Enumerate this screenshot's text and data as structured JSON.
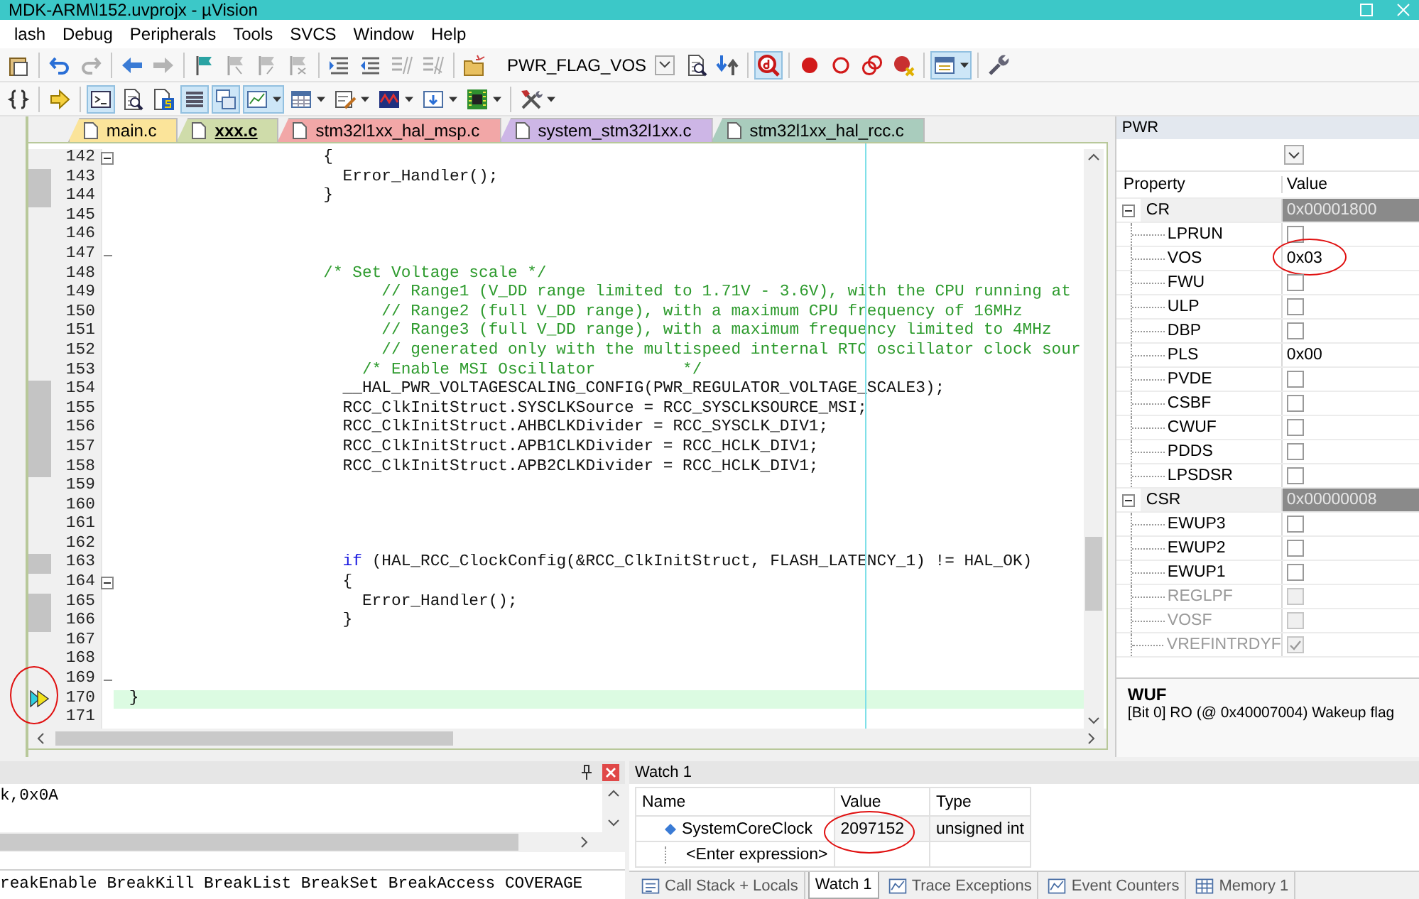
{
  "window": {
    "title": "MDK-ARM\\l152.uvprojx - µVision"
  },
  "menu": [
    "lash",
    "Debug",
    "Peripherals",
    "Tools",
    "SVCS",
    "Window",
    "Help"
  ],
  "toolbar_1": [
    {
      "kind": "button",
      "selected": false,
      "disabled": false,
      "dropdown": false
    },
    {
      "kind": "separator"
    },
    {
      "kind": "button",
      "selected": false,
      "disabled": false,
      "dropdown": false
    },
    {
      "kind": "button",
      "selected": false,
      "disabled": true,
      "dropdown": false
    },
    {
      "kind": "separator"
    },
    {
      "kind": "button",
      "selected": false,
      "disabled": false,
      "dropdown": false
    },
    {
      "kind": "button",
      "selected": false,
      "disabled": true,
      "dropdown": false
    },
    {
      "kind": "separator"
    },
    {
      "kind": "button",
      "selected": false,
      "disabled": false,
      "dropdown": false
    },
    {
      "kind": "button",
      "selected": false,
      "disabled": true,
      "dropdown": false
    },
    {
      "kind": "button",
      "selected": false,
      "disabled": true,
      "dropdown": false
    },
    {
      "kind": "button",
      "selected": false,
      "disabled": true,
      "dropdown": false
    },
    {
      "kind": "separator"
    },
    {
      "kind": "button",
      "selected": false,
      "disabled": false,
      "dropdown": false
    },
    {
      "kind": "button",
      "selected": false,
      "disabled": false,
      "dropdown": false
    },
    {
      "kind": "button",
      "selected": false,
      "disabled": true,
      "dropdown": false
    },
    {
      "kind": "button",
      "selected": false,
      "disabled": true,
      "dropdown": false
    },
    {
      "kind": "separator"
    },
    {
      "kind": "button",
      "selected": false,
      "disabled": false,
      "dropdown": false
    },
    {
      "kind": "combo",
      "value": "PWR_FLAG_VOS"
    },
    {
      "kind": "button",
      "selected": false,
      "disabled": false,
      "dropdown": false
    },
    {
      "kind": "button",
      "selected": false,
      "disabled": false,
      "dropdown": false
    },
    {
      "kind": "separator"
    },
    {
      "kind": "button",
      "selected": true,
      "disabled": false,
      "dropdown": false
    },
    {
      "kind": "separator"
    },
    {
      "kind": "button",
      "selected": false,
      "disabled": false,
      "dropdown": false
    },
    {
      "kind": "button",
      "selected": false,
      "disabled": false,
      "dropdown": false
    },
    {
      "kind": "button",
      "selected": false,
      "disabled": false,
      "dropdown": false
    },
    {
      "kind": "button",
      "selected": false,
      "disabled": false,
      "dropdown": false
    },
    {
      "kind": "separator"
    },
    {
      "kind": "button",
      "selected": true,
      "disabled": false,
      "dropdown": true
    },
    {
      "kind": "separator"
    },
    {
      "kind": "button",
      "selected": false,
      "disabled": false,
      "dropdown": false
    }
  ],
  "toolbar_2": [
    {
      "kind": "button",
      "selected": false,
      "disabled": false,
      "dropdown": false
    },
    {
      "kind": "separator"
    },
    {
      "kind": "button",
      "selected": false,
      "disabled": false,
      "dropdown": false
    },
    {
      "kind": "separator"
    },
    {
      "kind": "button",
      "selected": true,
      "disabled": false,
      "dropdown": false
    },
    {
      "kind": "button",
      "selected": false,
      "disabled": false,
      "dropdown": false
    },
    {
      "kind": "button",
      "selected": false,
      "disabled": false,
      "dropdown": false
    },
    {
      "kind": "button",
      "selected": true,
      "disabled": false,
      "dropdown": false
    },
    {
      "kind": "button",
      "selected": true,
      "disabled": false,
      "dropdown": false
    },
    {
      "kind": "button",
      "selected": true,
      "disabled": false,
      "dropdown": true
    },
    {
      "kind": "button",
      "selected": false,
      "disabled": false,
      "dropdown": true
    },
    {
      "kind": "button",
      "selected": false,
      "disabled": false,
      "dropdown": true
    },
    {
      "kind": "button",
      "selected": false,
      "disabled": false,
      "dropdown": true
    },
    {
      "kind": "button",
      "selected": false,
      "disabled": false,
      "dropdown": true
    },
    {
      "kind": "button",
      "selected": false,
      "disabled": false,
      "dropdown": true
    },
    {
      "kind": "separator"
    },
    {
      "kind": "button",
      "selected": false,
      "disabled": false,
      "dropdown": true
    }
  ],
  "editor_tabs": [
    {
      "label": "main.c",
      "selected": false,
      "color": "#fbe49a"
    },
    {
      "label": "xxx.c",
      "selected": true,
      "color": "#cfdcaa"
    },
    {
      "label": "stm32l1xx_hal_msp.c",
      "selected": false,
      "color": "#f2a7a7"
    },
    {
      "label": "system_stm32l1xx.c",
      "selected": false,
      "color": "#cdb6e6"
    },
    {
      "label": "stm32l1xx_hal_rcc.c",
      "selected": false,
      "color": "#a9ccbd"
    }
  ],
  "editor_lines": [
    {
      "number": "142",
      "covered": false,
      "current": false,
      "fold_start": true,
      "code": [
        {
          "kind": "plain",
          "text": "                    {"
        }
      ]
    },
    {
      "number": "143",
      "covered": true,
      "current": false,
      "code": [
        {
          "kind": "plain",
          "text": "                      Error_Handler();"
        }
      ]
    },
    {
      "number": "144",
      "covered": true,
      "current": false,
      "code": [
        {
          "kind": "plain",
          "text": "                    }"
        }
      ]
    },
    {
      "number": "145",
      "covered": false,
      "current": false
    },
    {
      "number": "146",
      "covered": false,
      "current": false
    },
    {
      "number": "147",
      "covered": false,
      "current": false,
      "fold_end": true
    },
    {
      "number": "148",
      "covered": false,
      "current": false,
      "code": [
        {
          "kind": "comment",
          "text": "                    /* Set Voltage scale */"
        }
      ]
    },
    {
      "number": "149",
      "covered": false,
      "current": false,
      "code": [
        {
          "kind": "comment",
          "text": "                          // Range1 (V_DD range limited to 1.71V - 3.6V), with the CPU running at"
        }
      ]
    },
    {
      "number": "150",
      "covered": false,
      "current": false,
      "code": [
        {
          "kind": "comment",
          "text": "                          // Range2 (full V_DD range), with a maximum CPU frequency of 16MHz"
        }
      ]
    },
    {
      "number": "151",
      "covered": false,
      "current": false,
      "code": [
        {
          "kind": "comment",
          "text": "                          // Range3 (full V_DD range), with a maximum frequency limited to 4MHz"
        }
      ]
    },
    {
      "number": "152",
      "covered": false,
      "current": false,
      "code": [
        {
          "kind": "comment",
          "text": "                          // generated only with the multispeed internal RTC oscillator clock sour"
        }
      ]
    },
    {
      "number": "153",
      "covered": false,
      "current": false,
      "code": [
        {
          "kind": "comment",
          "text": "                        /* Enable MSI Oscillator         */"
        }
      ]
    },
    {
      "number": "154",
      "covered": true,
      "current": false,
      "code": [
        {
          "kind": "plain",
          "text": "                      __HAL_PWR_VOLTAGESCALING_CONFIG(PWR_REGULATOR_VOLTAGE_SCALE3);"
        }
      ]
    },
    {
      "number": "155",
      "covered": true,
      "current": false,
      "code": [
        {
          "kind": "plain",
          "text": "                      RCC_ClkInitStruct.SYSCLKSource = RCC_SYSCLKSOURCE_MSI;"
        }
      ]
    },
    {
      "number": "156",
      "covered": true,
      "current": false,
      "code": [
        {
          "kind": "plain",
          "text": "                      RCC_ClkInitStruct.AHBCLKDivider = RCC_SYSCLK_DIV1;"
        }
      ]
    },
    {
      "number": "157",
      "covered": true,
      "current": false,
      "code": [
        {
          "kind": "plain",
          "text": "                      RCC_ClkInitStruct.APB1CLKDivider = RCC_HCLK_DIV1;"
        }
      ]
    },
    {
      "number": "158",
      "covered": true,
      "current": false,
      "code": [
        {
          "kind": "plain",
          "text": "                      RCC_ClkInitStruct.APB2CLKDivider = RCC_HCLK_DIV1;"
        }
      ]
    },
    {
      "number": "159",
      "covered": false,
      "current": false
    },
    {
      "number": "160",
      "covered": false,
      "current": false
    },
    {
      "number": "161",
      "covered": false,
      "current": false
    },
    {
      "number": "162",
      "covered": false,
      "current": false
    },
    {
      "number": "163",
      "covered": true,
      "current": false,
      "code": [
        {
          "kind": "keyword",
          "text": "                      if"
        },
        {
          "kind": "plain",
          "text": " (HAL_RCC_ClockConfig(&RCC_ClkInitStruct, FLASH_LATENCY_1) != HAL_OK)"
        }
      ]
    },
    {
      "number": "164",
      "covered": false,
      "current": false,
      "fold_start": true,
      "code": [
        {
          "kind": "plain",
          "text": "                      {"
        }
      ]
    },
    {
      "number": "165",
      "covered": true,
      "current": false,
      "code": [
        {
          "kind": "plain",
          "text": "                        Error_Handler();"
        }
      ]
    },
    {
      "number": "166",
      "covered": true,
      "current": false,
      "code": [
        {
          "kind": "plain",
          "text": "                      }"
        }
      ]
    },
    {
      "number": "167",
      "covered": false,
      "current": false
    },
    {
      "number": "168",
      "covered": false,
      "current": false
    },
    {
      "number": "169",
      "covered": false,
      "current": false,
      "fold_end": true
    },
    {
      "number": "170",
      "covered": false,
      "current": true,
      "annotated": true,
      "code": [
        {
          "kind": "plain",
          "text": "}"
        }
      ]
    },
    {
      "number": "171",
      "covered": false,
      "current": false
    }
  ],
  "pwr_panel": {
    "title": "PWR",
    "columns": [
      "Property",
      "Value"
    ],
    "registers": [
      {
        "name": "CR",
        "value": "0x00001800",
        "expanded": true,
        "children": [
          {
            "name": "LPRUN",
            "kind": "check",
            "checked": false,
            "read_only": false
          },
          {
            "name": "VOS",
            "kind": "value",
            "value": "0x03",
            "annotated": true,
            "read_only": false
          },
          {
            "name": "FWU",
            "kind": "check",
            "checked": false,
            "read_only": false
          },
          {
            "name": "ULP",
            "kind": "check",
            "checked": false,
            "read_only": false
          },
          {
            "name": "DBP",
            "kind": "check",
            "checked": false,
            "read_only": false
          },
          {
            "name": "PLS",
            "kind": "value",
            "value": "0x00",
            "read_only": false
          },
          {
            "name": "PVDE",
            "kind": "check",
            "checked": false,
            "read_only": false
          },
          {
            "name": "CSBF",
            "kind": "check",
            "checked": false,
            "read_only": false
          },
          {
            "name": "CWUF",
            "kind": "check",
            "checked": false,
            "read_only": false
          },
          {
            "name": "PDDS",
            "kind": "check",
            "checked": false,
            "read_only": false
          },
          {
            "name": "LPSDSR",
            "kind": "check",
            "checked": false,
            "read_only": false
          }
        ]
      },
      {
        "name": "CSR",
        "value": "0x00000008",
        "expanded": true,
        "children": [
          {
            "name": "EWUP3",
            "kind": "check",
            "checked": false,
            "read_only": false
          },
          {
            "name": "EWUP2",
            "kind": "check",
            "checked": false,
            "read_only": false
          },
          {
            "name": "EWUP1",
            "kind": "check",
            "checked": false,
            "read_only": false
          },
          {
            "name": "REGLPF",
            "kind": "check",
            "checked": false,
            "read_only": true
          },
          {
            "name": "VOSF",
            "kind": "check",
            "checked": false,
            "read_only": true
          },
          {
            "name": "VREFINTRDYF",
            "kind": "check",
            "checked": true,
            "read_only": true
          }
        ]
      }
    ],
    "description": {
      "title": "WUF",
      "text": "[Bit 0] RO (@ 0x40007004) Wakeup flag"
    }
  },
  "command": {
    "output": [
      "k,0x0A"
    ],
    "hint": "reakEnable BreakKill BreakList BreakSet BreakAccess COVERAGE"
  },
  "watch": {
    "title": "Watch 1",
    "columns": [
      "Name",
      "Value",
      "Type"
    ],
    "rows": [
      {
        "name": "SystemCoreClock",
        "value": "2097152",
        "type": "unsigned int",
        "annotated": true
      }
    ],
    "new_row": "<Enter expression>",
    "tabs": [
      {
        "label": "Call Stack + Locals",
        "selected": false
      },
      {
        "label": "Watch 1",
        "selected": true
      },
      {
        "label": "Trace Exceptions",
        "selected": false
      },
      {
        "label": "Event Counters",
        "selected": false
      },
      {
        "label": "Memory 1",
        "selected": false
      }
    ]
  }
}
